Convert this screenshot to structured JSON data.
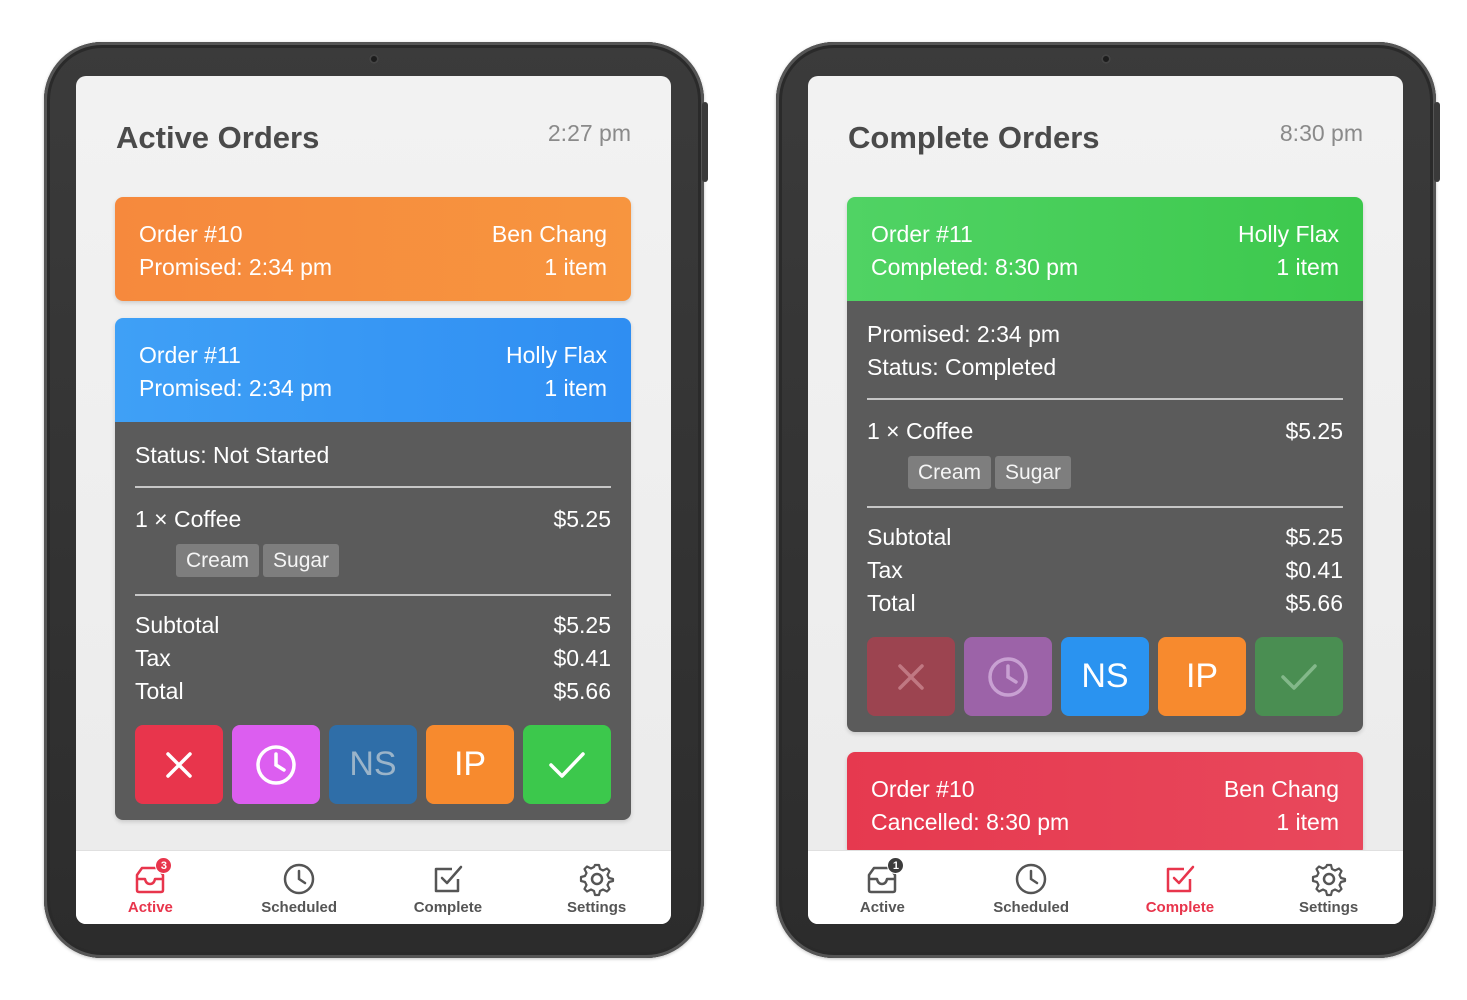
{
  "left": {
    "header": {
      "title": "Active Orders",
      "time": "2:27 pm"
    },
    "orders": [
      {
        "number": "Order #10",
        "sub": "Promised: 2:34 pm",
        "customer": "Ben Chang",
        "items": "1 item"
      },
      {
        "number": "Order #11",
        "sub": "Promised: 2:34 pm",
        "customer": "Holly Flax",
        "items": "1 item",
        "status": "Status: Not Started",
        "line_item": {
          "qty_name": "1 × Coffee",
          "price": "$5.25",
          "tags": [
            "Cream",
            "Sugar"
          ]
        },
        "totals": [
          {
            "label": "Subtotal",
            "value": "$5.25"
          },
          {
            "label": "Tax",
            "value": "$0.41"
          },
          {
            "label": "Total",
            "value": "$5.66"
          }
        ],
        "actions": {
          "ns": "NS",
          "ip": "IP"
        }
      }
    ],
    "tabbar": {
      "active_badge": "3"
    }
  },
  "right": {
    "header": {
      "title": "Complete Orders",
      "time": "8:30 pm"
    },
    "orders": [
      {
        "number": "Order #11",
        "sub": "Completed: 8:30 pm",
        "customer": "Holly Flax",
        "items": "1 item",
        "promised": "Promised: 2:34 pm",
        "status": "Status: Completed",
        "line_item": {
          "qty_name": "1 × Coffee",
          "price": "$5.25",
          "tags": [
            "Cream",
            "Sugar"
          ]
        },
        "totals": [
          {
            "label": "Subtotal",
            "value": "$5.25"
          },
          {
            "label": "Tax",
            "value": "$0.41"
          },
          {
            "label": "Total",
            "value": "$5.66"
          }
        ],
        "actions": {
          "ns": "NS",
          "ip": "IP"
        }
      },
      {
        "number": "Order #10",
        "sub": "Cancelled: 8:30 pm",
        "customer": "Ben Chang",
        "items": "1 item"
      }
    ],
    "tabbar": {
      "active_badge": "1"
    }
  },
  "tabs": [
    "Active",
    "Scheduled",
    "Complete",
    "Settings"
  ],
  "colors": {
    "accent": "#e8354c",
    "orange": "#f78a2e",
    "blue": "#2f8ef2",
    "green": "#3cc84c",
    "red": "#e6394f",
    "purple": "#dc5ef0",
    "card_body": "#5b5b5b"
  },
  "icons": [
    "inbox-icon",
    "clock-icon",
    "check-square-icon",
    "gear-icon",
    "close-icon",
    "checkmark-icon"
  ]
}
